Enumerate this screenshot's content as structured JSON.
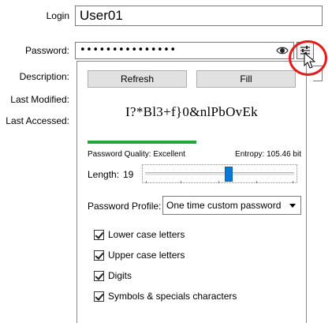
{
  "labels": {
    "login": "Login",
    "password": "Password:",
    "description": "Description:",
    "last_modified": "Last Modified:",
    "last_accessed": "Last Accessed:"
  },
  "fields": {
    "login_value": "User01",
    "password_masked": "•••••••••••••••"
  },
  "icons": {
    "reveal": "eye-icon",
    "generator": "sliders-icon",
    "cursor": "mouse-pointer-icon"
  },
  "generator": {
    "refresh_label": "Refresh",
    "fill_label": "Fill",
    "generated_password": "I?*Bl3+f}0&nlPbOvEk",
    "quality_label": "Password Quality: Excellent",
    "entropy_label": "Entropy: 105.46 bit",
    "quality_fraction": 0.46,
    "length_label": "Length:",
    "length_value": "19",
    "length_slider_fraction": 0.56,
    "profile_label": "Password Profile:",
    "profile_value": "One time custom password",
    "options": [
      {
        "label": "Lower case letters",
        "checked": true
      },
      {
        "label": "Upper case letters",
        "checked": true
      },
      {
        "label": "Digits",
        "checked": true
      },
      {
        "label": "Symbols & specials characters",
        "checked": true
      }
    ]
  },
  "colors": {
    "quality_bar": "#1fa73a",
    "slider_thumb": "#0a7ad6",
    "highlight": "#e41c1c"
  }
}
